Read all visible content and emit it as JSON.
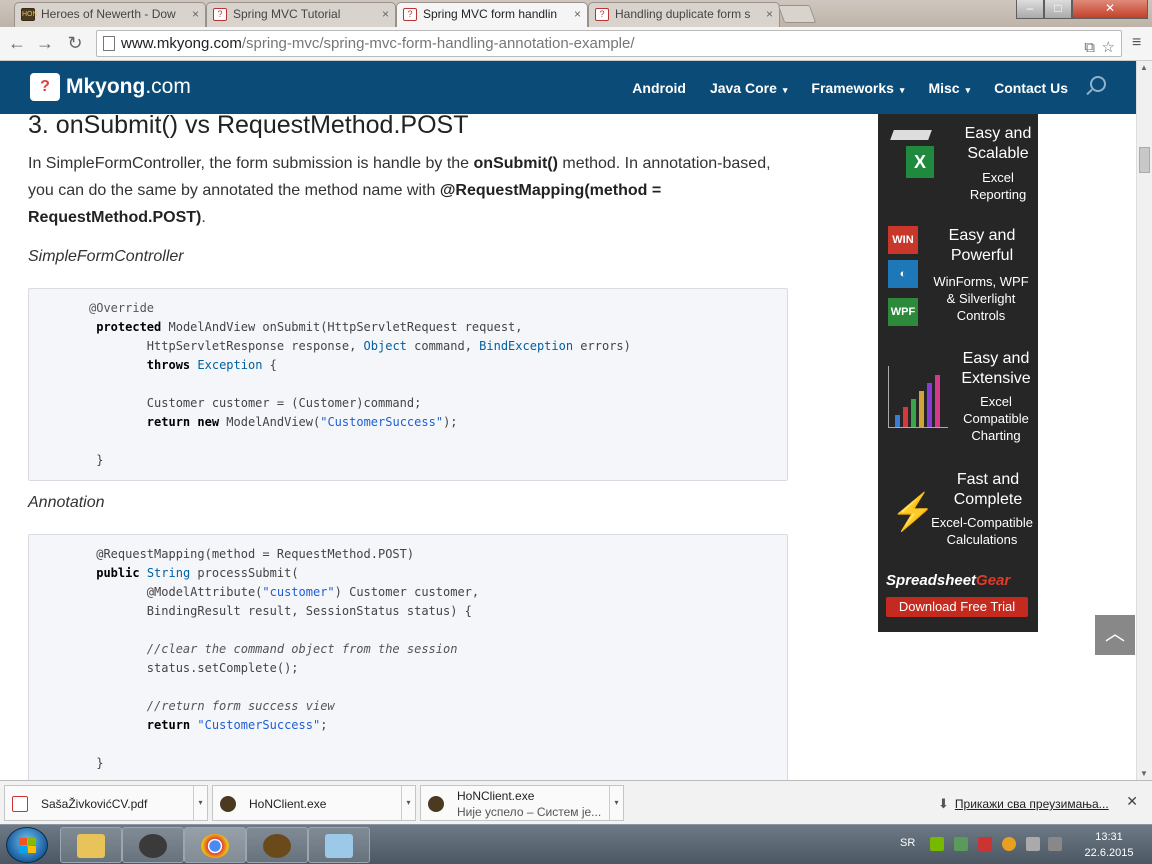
{
  "browser": {
    "tabs": [
      {
        "title": "Heroes of Newerth - Dow",
        "icon": "hon-icon"
      },
      {
        "title": "Spring MVC Tutorial",
        "icon": "mkyong-icon"
      },
      {
        "title": "Spring MVC form handlin",
        "icon": "mkyong-icon",
        "active": true
      },
      {
        "title": "Handling duplicate form s",
        "icon": "mkyong-icon"
      }
    ],
    "tab_close": "×",
    "url_host": "www.mkyong.com",
    "url_path": "/spring-mvc/spring-mvc-form-handling-annotation-example/",
    "window_controls": {
      "minimize": "–",
      "maximize": "□",
      "close": "✕"
    }
  },
  "site": {
    "logo_text": "Mkyong",
    "logo_domain": ".com",
    "logo_mark": "?",
    "nav": [
      "Android",
      "Java Core",
      "Frameworks",
      "Misc",
      "Contact Us"
    ],
    "nav_dropdown": [
      false,
      true,
      true,
      true,
      false
    ],
    "caret": "▾"
  },
  "article": {
    "heading": "3. onSubmit() vs RequestMethod.POST",
    "para_1": "In SimpleFormController, the form submission is handle by the ",
    "para_b1": "onSubmit()",
    "para_2": " method. In annotation-based, you can do the same by annotated the method name with ",
    "para_b2": "@RequestMapping(method = RequestMethod.POST)",
    "para_3": ".",
    "sub_1": "SimpleFormController",
    "sub_2": "Annotation"
  },
  "ad": {
    "block1_title": "Easy and Scalable",
    "block1_sub": "Excel Reporting",
    "block2_title": "Easy and Powerful",
    "block2_sub": "WinForms, WPF & Silverlight Controls",
    "block2_badges": [
      "WIN",
      "WPF"
    ],
    "block3_title": "Easy and Extensive",
    "block3_sub": "Excel Compatible Charting",
    "block4_title": "Fast and Complete",
    "block4_sub": "Excel-Compatible Calculations",
    "brand_a": "Spreadsheet",
    "brand_b": "Gear",
    "button": "Download Free Trial",
    "colors": {
      "bg": "#262626",
      "accent": "#c42a1e"
    }
  },
  "back_to_top": "^",
  "downloads": {
    "items": [
      {
        "name": "SašaŽivkovićCV.pdf",
        "icon": "pdf-icon"
      },
      {
        "name": "HoNClient.exe",
        "icon": "hon-icon"
      },
      {
        "name": "HoNClient.exe",
        "status": "Није успело – Систем је...",
        "icon": "hon-icon"
      }
    ],
    "show_all": "Прикажи сва преузимања...",
    "close": "✕"
  },
  "taskbar": {
    "lang": "SR",
    "time": "13:31",
    "date": "22.6.2015"
  }
}
